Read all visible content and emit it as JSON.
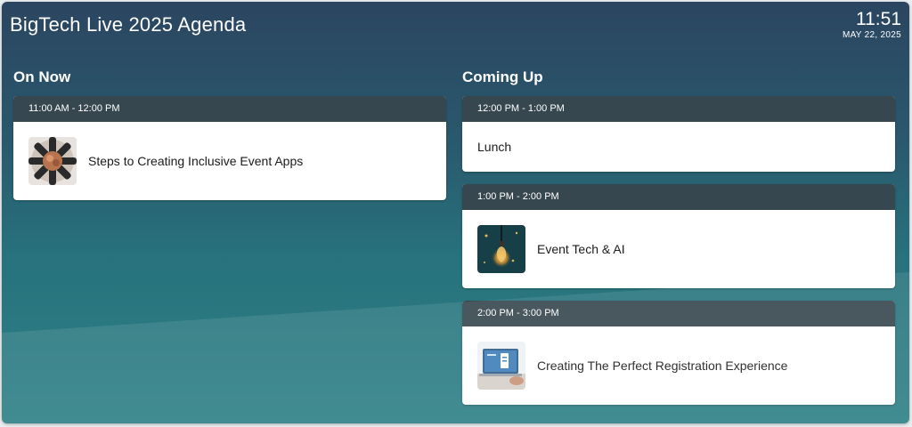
{
  "header": {
    "title": "BigTech Live 2025 Agenda",
    "clock_time": "11:51",
    "clock_date": "MAY 22, 2025"
  },
  "sections": {
    "on_now": "On Now",
    "coming_up": "Coming Up"
  },
  "on_now": [
    {
      "time": "11:00 AM - 12:00 PM",
      "title": "Steps to Creating Inclusive Event Apps",
      "image": "team-hands-photo"
    }
  ],
  "coming_up": [
    {
      "time": "12:00 PM - 1:00 PM",
      "title": "Lunch"
    },
    {
      "time": "1:00 PM - 2:00 PM",
      "title": "Event Tech & AI",
      "image": "lightbulb-photo"
    },
    {
      "time": "2:00 PM - 3:00 PM",
      "title": "Creating The Perfect Registration Experience",
      "image": "laptop-registration-photo"
    }
  ],
  "colors": {
    "card_header": "#37474f",
    "background_top": "#2b4560",
    "background_bottom": "#2f8187"
  }
}
